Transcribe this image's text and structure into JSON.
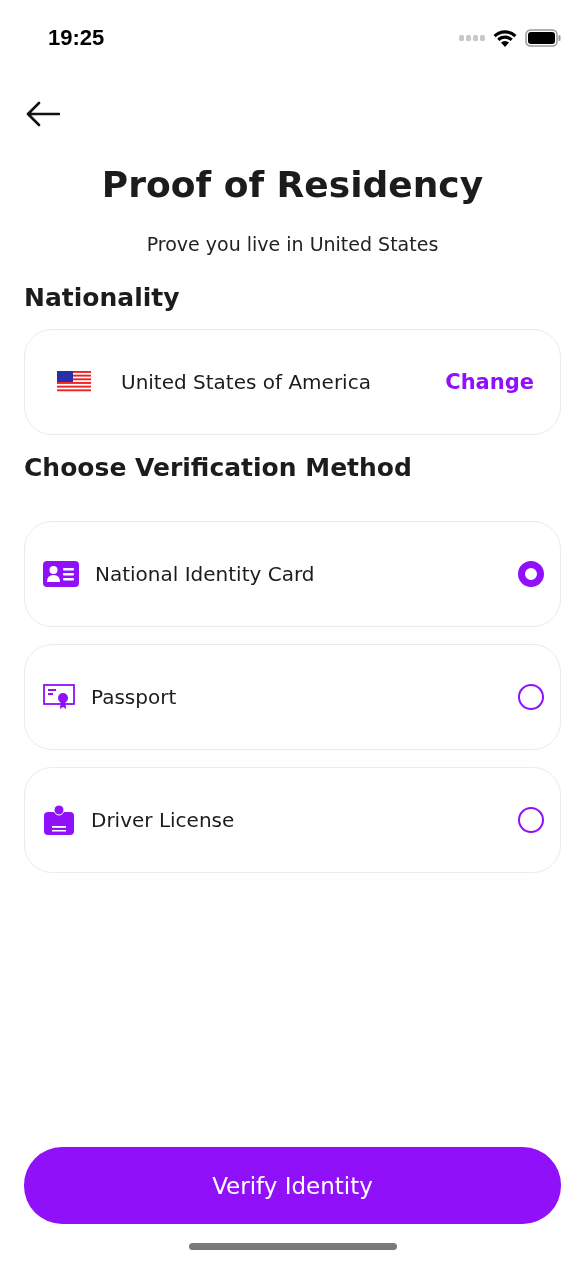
{
  "status_bar": {
    "time": "19:25"
  },
  "title": "Proof of Residency",
  "subtitle": "Prove you live in United States",
  "nationality": {
    "heading": "Nationality",
    "country": "United States of America",
    "action": "Change"
  },
  "methods_heading": "Choose Verification Method",
  "methods": [
    {
      "kind": "id_card",
      "label": "National Identity Card",
      "selected": true
    },
    {
      "kind": "passport",
      "label": "Passport",
      "selected": false
    },
    {
      "kind": "license",
      "label": "Driver License",
      "selected": false
    }
  ],
  "primary_button": "Verify Identity"
}
